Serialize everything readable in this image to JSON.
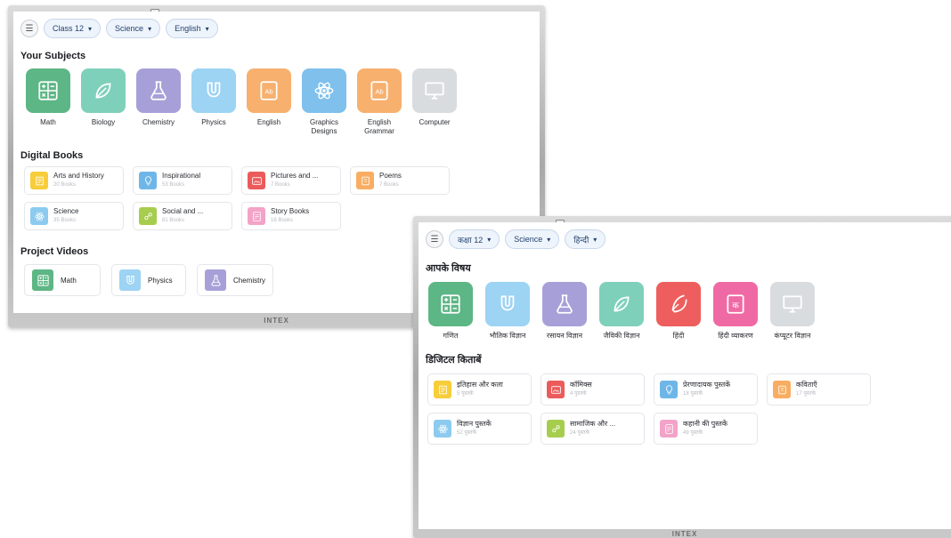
{
  "brand": "INTEX",
  "screen_en": {
    "filters": [
      {
        "label": "Class 12"
      },
      {
        "label": "Science"
      },
      {
        "label": "English"
      }
    ],
    "subjects_title": "Your Subjects",
    "subjects": [
      {
        "label": "Math",
        "color": "#5db685",
        "icon": "calculator-icon"
      },
      {
        "label": "Biology",
        "color": "#7fd0bb",
        "icon": "leaf-icon"
      },
      {
        "label": "Chemistry",
        "color": "#a7a0d8",
        "icon": "flask-icon"
      },
      {
        "label": "Physics",
        "color": "#9dd3f3",
        "icon": "magnet-icon"
      },
      {
        "label": "English",
        "color": "#f7b06e",
        "icon": "book-ab-icon"
      },
      {
        "label": "Graphics Designs",
        "color": "#7fc0ec",
        "icon": "atom-icon"
      },
      {
        "label": "English Grammar",
        "color": "#f7b06e",
        "icon": "book-ab-icon"
      },
      {
        "label": "Computer",
        "color": "#d9dcdf",
        "icon": "monitor-icon"
      }
    ],
    "books_title": "Digital Books",
    "books": [
      {
        "name": "Arts and History",
        "count": "20 Books",
        "color": "#f7cd3a",
        "icon": "history-icon"
      },
      {
        "name": "Inspirational",
        "count": "53 Books",
        "color": "#6fb6e8",
        "icon": "bulb-icon"
      },
      {
        "name": "Pictures and ...",
        "count": "7 Books",
        "color": "#ec5b5b",
        "icon": "picture-icon"
      },
      {
        "name": "Poems",
        "count": "7 Books",
        "color": "#f8ad62",
        "icon": "poem-icon"
      },
      {
        "name": "Science",
        "count": "35 Books",
        "color": "#8ccbef",
        "icon": "atom-icon"
      },
      {
        "name": "Social and ...",
        "count": "81 Books",
        "color": "#a7cd4e",
        "icon": "social-icon"
      },
      {
        "name": "Story Books",
        "count": "16 Books",
        "color": "#f3a2c8",
        "icon": "story-icon"
      }
    ],
    "videos_title": "Project Videos",
    "videos": [
      {
        "label": "Math",
        "color": "#5db685",
        "icon": "calculator-icon"
      },
      {
        "label": "Physics",
        "color": "#9dd3f3",
        "icon": "magnet-icon"
      },
      {
        "label": "Chemistry",
        "color": "#a7a0d8",
        "icon": "flask-icon"
      }
    ]
  },
  "screen_hi": {
    "filters": [
      {
        "label": "कक्षा 12"
      },
      {
        "label": "Science"
      },
      {
        "label": "हिन्दी"
      }
    ],
    "subjects_title": "आपके विषय",
    "subjects": [
      {
        "label": "गणित",
        "color": "#5db685",
        "icon": "calculator-icon"
      },
      {
        "label": "भौतिक विज्ञान",
        "color": "#9dd3f3",
        "icon": "magnet-icon"
      },
      {
        "label": "रसायन विज्ञान",
        "color": "#a7a0d8",
        "icon": "flask-icon"
      },
      {
        "label": "जैविकी विज्ञान",
        "color": "#7fd0bb",
        "icon": "leaf-icon"
      },
      {
        "label": "हिंदी",
        "color": "#ee5e5e",
        "icon": "quill-icon"
      },
      {
        "label": "हिंदी व्याकरण",
        "color": "#ef6aa5",
        "icon": "book-ka-icon"
      },
      {
        "label": "कंप्यूटर विज्ञान",
        "color": "#d9dcdf",
        "icon": "monitor-icon"
      }
    ],
    "books_title": "डिजिटल किताबें",
    "books": [
      {
        "name": "इतिहास और कला",
        "count": "5 पुस्तकें",
        "color": "#f7cd3a",
        "icon": "history-icon"
      },
      {
        "name": "कॉमिक्स",
        "count": "4 पुस्तकें",
        "color": "#ec5b5b",
        "icon": "picture-icon"
      },
      {
        "name": "प्रेरणादायक पुस्तकें",
        "count": "18 पुस्तकें",
        "color": "#6fb6e8",
        "icon": "bulb-icon"
      },
      {
        "name": "कविताएँ",
        "count": "17 पुस्तकें",
        "color": "#f8ad62",
        "icon": "poem-icon"
      },
      {
        "name": "विज्ञान पुस्तकें",
        "count": "52 पुस्तकें",
        "color": "#8ccbef",
        "icon": "atom-icon"
      },
      {
        "name": "सामाजिक और ...",
        "count": "24 पुस्तकें",
        "color": "#a7cd4e",
        "icon": "social-icon"
      },
      {
        "name": "कहानी की पुस्तकें",
        "count": "49 पुस्तकें",
        "color": "#f3a2c8",
        "icon": "story-icon"
      }
    ]
  }
}
